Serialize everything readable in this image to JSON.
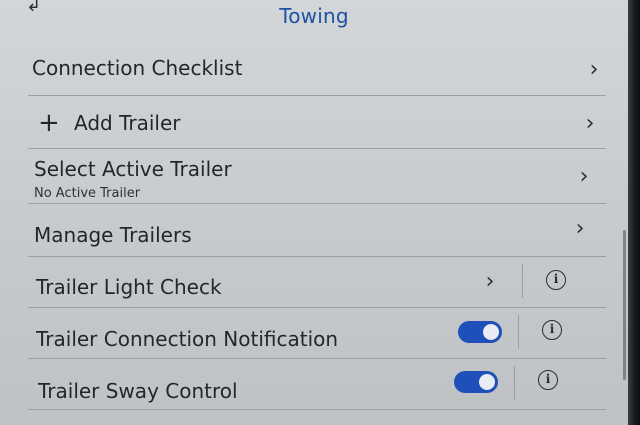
{
  "header": {
    "back_glyph": "↲",
    "title": "Towing"
  },
  "menu": [
    {
      "label": "Connection Checklist",
      "chevron": "›"
    },
    {
      "label": "Add Trailer",
      "icon": "plus-icon",
      "plus_glyph": "+",
      "chevron": "›"
    },
    {
      "label": "Select Active Trailer",
      "sublabel": "No Active Trailer",
      "chevron": "›"
    },
    {
      "label": "Manage Trailers",
      "chevron": "›"
    },
    {
      "label": "Trailer Light Check",
      "chevron": "›",
      "info": "i"
    },
    {
      "label": "Trailer Connection Notification",
      "toggle_on": true,
      "info": "i"
    },
    {
      "label": "Trailer Sway Control",
      "toggle_on": true,
      "info": "i"
    }
  ],
  "colors": {
    "title": "#1f52a3",
    "toggle_on": "#1f4fb8"
  }
}
